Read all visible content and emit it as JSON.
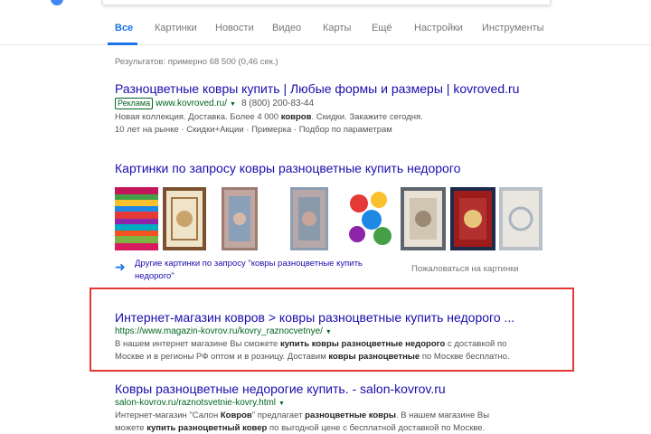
{
  "tabs": [
    {
      "label": "Все",
      "active": true
    },
    {
      "label": "Картинки"
    },
    {
      "label": "Новости"
    },
    {
      "label": "Видео"
    },
    {
      "label": "Карты"
    },
    {
      "label": "Ещё"
    },
    {
      "label": "Настройки"
    },
    {
      "label": "Инструменты"
    }
  ],
  "stats": "Результатов: примерно 68 500 (0,46 сек.)",
  "ad": {
    "title": "Разноцветные ковры купить | Любые формы и размеры | kovroved.ru",
    "badge": "Реклама",
    "url": "www.kovroved.ru/",
    "phone": "8 (800) 200-83-44",
    "snip1_a": "Новая коллекция. Доставка. Более 4 000 ",
    "snip1_b": "ковров",
    "snip1_c": ". Скидки. Закажите сегодня.",
    "snip2": "10 лет на рынке · Скидки+Акции · Примерка · Подбор по параметрам"
  },
  "images": {
    "heading": "Картинки по запросу ковры разноцветные купить недорого",
    "more": "Другие картинки по запросу \"ковры разноцветные купить недорого\"",
    "complain": "Пожаловаться на картинки"
  },
  "result1": {
    "title": "Интернет-магазин ковров > ковры разноцветные купить недорого ...",
    "url": "https://www.magazin-kovrov.ru/kovry_raznocvetnye/",
    "s1": "В нашем интернет магазине Вы сможете ",
    "s2": "купить ковры разноцветные недорого",
    "s3": " с доставкой по",
    "s4": "Москве и в регионы РФ оптом и в розницу. Доставим ",
    "s5": "ковры разноцветные",
    "s6": " по Москве бесплатно."
  },
  "result2": {
    "title": "Ковры разноцветные недорогие купить. - salon-kovrov.ru",
    "url": "salon-kovrov.ru/raznotsvetnie-kovry.html",
    "s1": "Интернет-магазин \"Салон ",
    "s2": "Ковров",
    "s3": "\" предлагает ",
    "s4": "разноцветные ковры",
    "s5": ". В нашем магазине Вы",
    "s6": "можете ",
    "s7": "купить разноцветный ковер",
    "s8": " по выгодной цене с бесплатной доставкой по Москве."
  },
  "colors": {
    "link": "#1a0dab",
    "url": "#006621",
    "accent": "#1a73e8",
    "highlight": "#e53935"
  }
}
